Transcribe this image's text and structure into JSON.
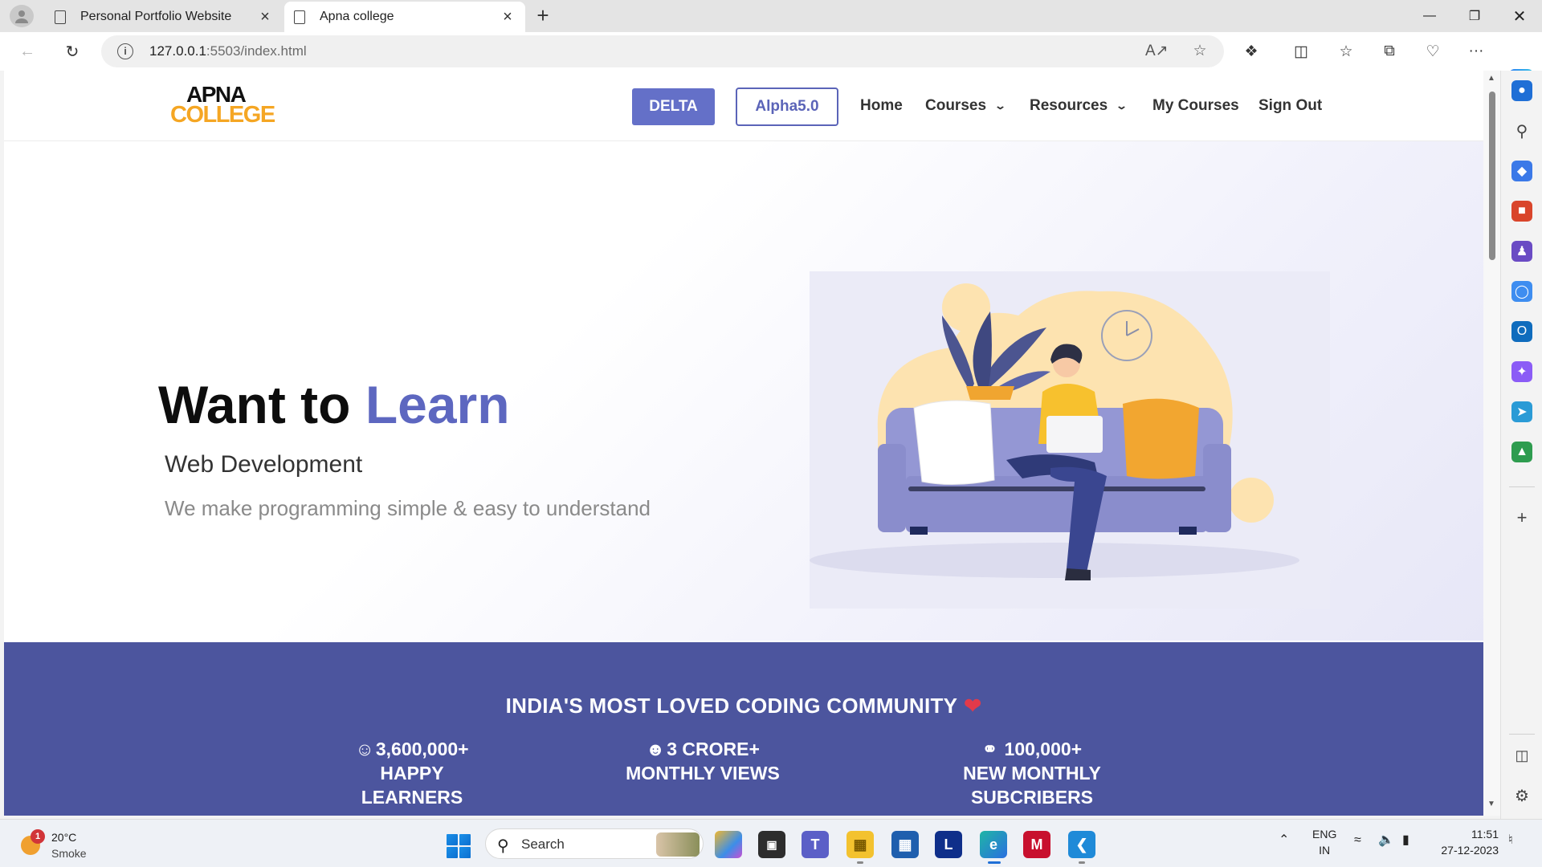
{
  "browser": {
    "tabs": [
      {
        "title": "Personal Portfolio Website",
        "active": false
      },
      {
        "title": "Apna college",
        "active": true
      }
    ],
    "url_host": "127.0.0.1",
    "url_rest": ":5503/index.html",
    "window_controls": [
      "minimize",
      "restore",
      "close"
    ]
  },
  "site": {
    "logo": {
      "line1": "APNA",
      "line2": "COLLEGE"
    },
    "nav": {
      "delta": "DELTA",
      "alpha": "Alpha5.0",
      "home": "Home",
      "courses": "Courses",
      "resources": "Resources",
      "my_courses": "My Courses",
      "sign_out": "Sign Out"
    },
    "hero": {
      "title_prefix": "Want to ",
      "title_accent": "Learn",
      "subtitle": "Web Development",
      "tagline": "We make programming simple & easy to understand"
    },
    "community": {
      "heading": "INDIA'S MOST LOVED CODING COMMUNITY",
      "stats": [
        {
          "value": "3,600,000+",
          "label": "HAPPY LEARNERS",
          "icon": "users-icon"
        },
        {
          "value": "3 CRORE+",
          "label": "MONTHLY VIEWS",
          "icon": "user-laptop-icon"
        },
        {
          "value": "100,000+",
          "label": "NEW MONTHLY SUBCRIBERS",
          "icon": "link-icon"
        }
      ]
    }
  },
  "colors": {
    "accent": "#5d67c0",
    "community_bg": "#4c559e",
    "logo_orange": "#f5a623",
    "delta_bg": "#6470c8"
  },
  "taskbar": {
    "weather": {
      "temp": "20°C",
      "condition": "Smoke",
      "badge": "1"
    },
    "search_label": "Search",
    "lang_line1": "ENG",
    "lang_line2": "IN",
    "time": "11:51",
    "date": "27-12-2023"
  }
}
